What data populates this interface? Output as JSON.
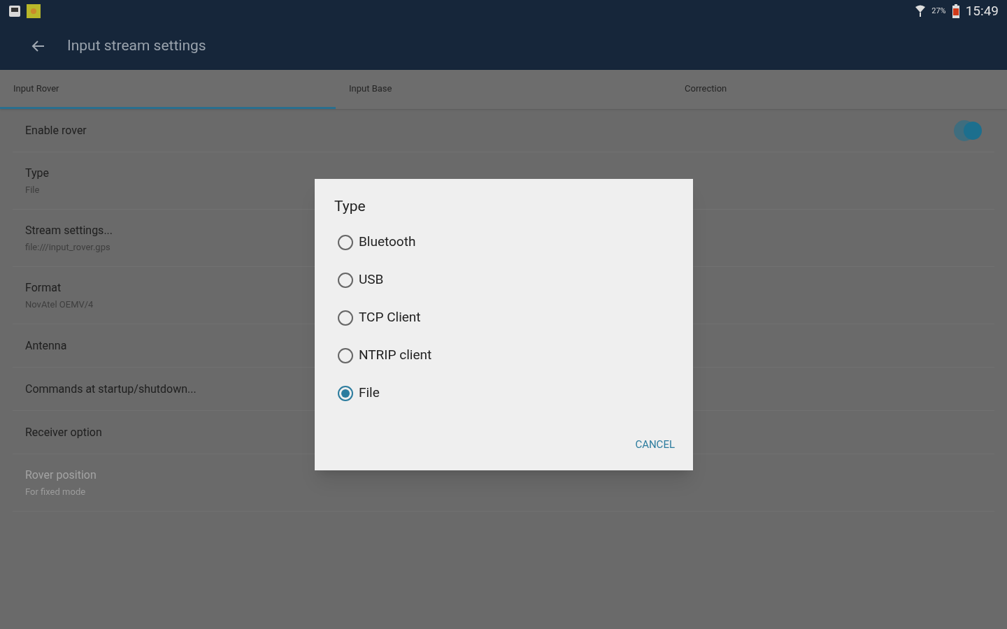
{
  "status_bar": {
    "battery": "27%",
    "time": "15:49"
  },
  "app_bar": {
    "title": "Input stream settings"
  },
  "tabs": [
    {
      "label": "Input Rover",
      "selected": true
    },
    {
      "label": "Input Base",
      "selected": false
    },
    {
      "label": "Correction",
      "selected": false
    }
  ],
  "settings": [
    {
      "kind": "switch",
      "title": "Enable rover",
      "on": true,
      "disabled": false
    },
    {
      "kind": "item",
      "title": "Type",
      "summary": "File",
      "disabled": false
    },
    {
      "kind": "item",
      "title": "Stream settings...",
      "summary": "file:///input_rover.gps",
      "disabled": false
    },
    {
      "kind": "item",
      "title": "Format",
      "summary": "NovAtel OEMV/4",
      "disabled": false
    },
    {
      "kind": "item",
      "title": "Antenna",
      "disabled": false
    },
    {
      "kind": "item",
      "title": "Commands at startup/shutdown...",
      "disabled": false
    },
    {
      "kind": "item",
      "title": "Receiver option",
      "disabled": false
    },
    {
      "kind": "item",
      "title": "Rover position",
      "summary": "For fixed mode",
      "disabled": true
    }
  ],
  "dialog": {
    "title": "Type",
    "options": [
      {
        "label": "Bluetooth",
        "selected": false
      },
      {
        "label": "USB",
        "selected": false
      },
      {
        "label": "TCP Client",
        "selected": false
      },
      {
        "label": "NTRIP client",
        "selected": false
      },
      {
        "label": "File",
        "selected": true
      }
    ],
    "button": "CANCEL"
  }
}
